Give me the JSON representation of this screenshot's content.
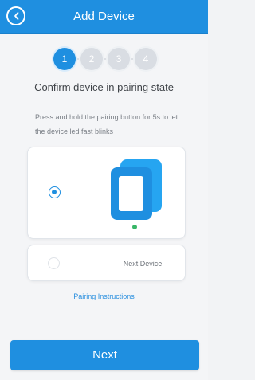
{
  "header": {
    "title": "Add Device",
    "back_icon": "chevron-left-icon"
  },
  "steps": [
    {
      "label": "1",
      "state": "active"
    },
    {
      "label": "2",
      "state": "inactive"
    },
    {
      "label": "3",
      "state": "inactive"
    },
    {
      "label": "4",
      "state": "inactive"
    }
  ],
  "content": {
    "title": "Confirm device in pairing state",
    "instruction": "Press and hold the pairing button for 5s to let the device led fast blinks"
  },
  "options": [
    {
      "selected": true,
      "icon": "device-icon",
      "status_led_color": "#38b667"
    },
    {
      "selected": false,
      "label": "Next Device"
    }
  ],
  "links": {
    "pairing_instructions": "Pairing Instructions"
  },
  "footer": {
    "next_label": "Next"
  },
  "colors": {
    "primary": "#1f8fe0",
    "step_inactive": "#d9dde3",
    "background": "#f4f5f7",
    "link": "#2b90df",
    "led_green": "#38b667"
  }
}
